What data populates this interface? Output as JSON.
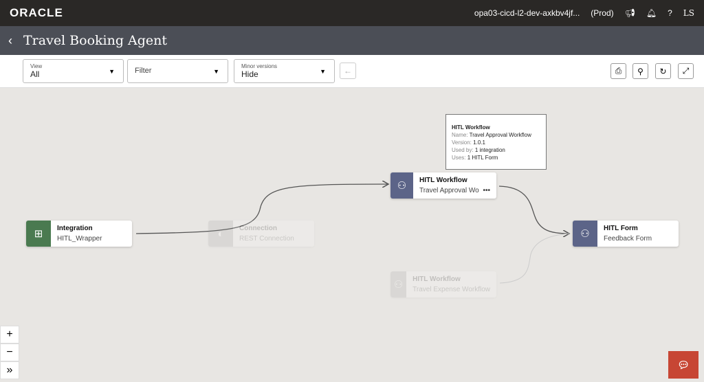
{
  "header": {
    "logo": "ORACLE",
    "instance": "opa03-cicd-l2-dev-axkbv4jf...",
    "env": "(Prod)",
    "user": "LS"
  },
  "title": "Travel Booking Agent",
  "toolbar": {
    "view_label": "View",
    "view_value": "All",
    "filter_label": "Filter",
    "minor_label": "Minor versions",
    "minor_value": "Hide"
  },
  "nodes": {
    "integration": {
      "type": "Integration",
      "name": "HITL_Wrapper",
      "color": "#4a7a50"
    },
    "connection": {
      "type": "Connection",
      "name": "REST Connection"
    },
    "workflow": {
      "type": "HITL Workflow",
      "name": "Travel Approval Wo",
      "more": "•••",
      "color": "#5c6488"
    },
    "form": {
      "type": "HITL Form",
      "name": "Feedback Form",
      "color": "#5c6488"
    },
    "workflow2": {
      "type": "HITL Workflow",
      "name": "Travel Expense Workflow"
    }
  },
  "tooltip": {
    "title": "HITL Workflow",
    "name_k": "Name:",
    "name_v": "Travel Approval Workflow",
    "version_k": "Version:",
    "version_v": "1.0.1",
    "usedby_k": "Used by:",
    "usedby_v": "1 integration",
    "uses_k": "Uses:",
    "uses_v": "1 HITL Form"
  },
  "zoom": {
    "in": "+",
    "out": "−",
    "expand": "»"
  }
}
